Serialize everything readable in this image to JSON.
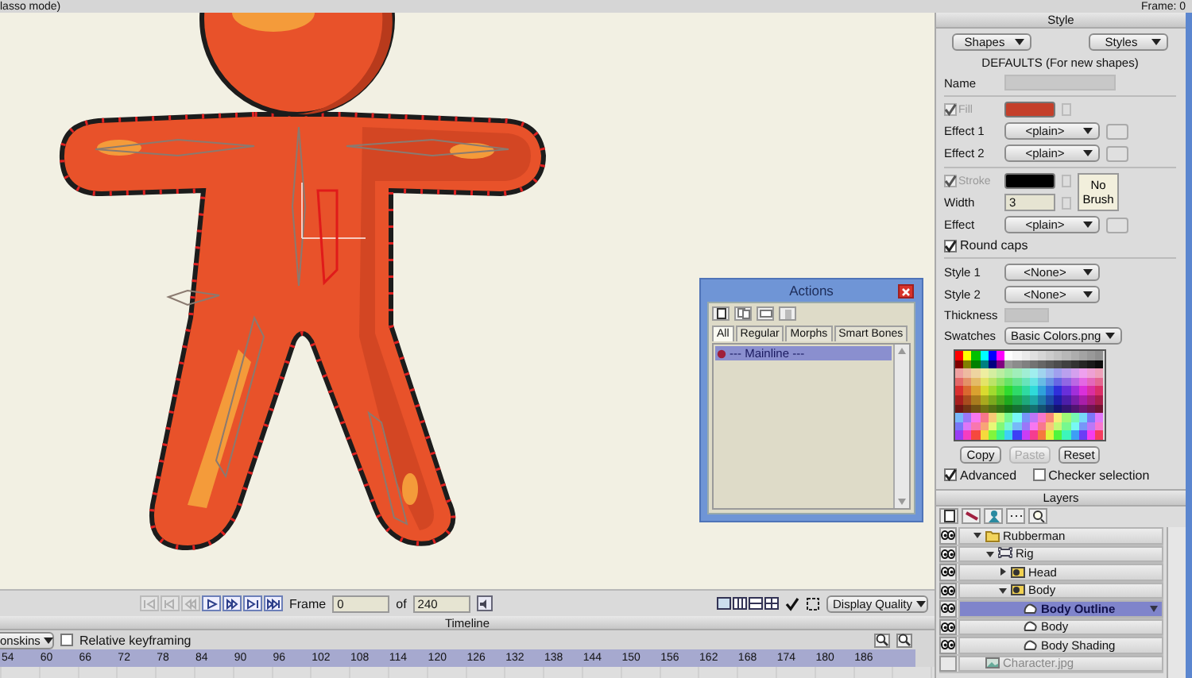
{
  "status_bar": {
    "mode_text": "lasso mode)",
    "frame": "Frame: 0"
  },
  "actions_window": {
    "title": "Actions",
    "tabs": [
      {
        "label": "All",
        "selected": true
      },
      {
        "label": "Regular",
        "selected": false
      },
      {
        "label": "Morphs",
        "selected": false
      },
      {
        "label": "Smart Bones",
        "selected": false
      }
    ],
    "items": [
      {
        "label": "--- Mainline ---",
        "selected": true
      }
    ]
  },
  "playback": {
    "transport": [
      {
        "kind": "first",
        "disabled": true
      },
      {
        "kind": "prev_key",
        "disabled": true
      },
      {
        "kind": "prev_frame",
        "disabled": true
      },
      {
        "kind": "play",
        "disabled": false
      },
      {
        "kind": "next_frame",
        "disabled": false
      },
      {
        "kind": "next_key",
        "disabled": false
      },
      {
        "kind": "last",
        "disabled": false
      }
    ],
    "frame_label": "Frame",
    "frame_value": "0",
    "of_label": "of",
    "total_frames": "240",
    "display_quality": "Display Quality"
  },
  "timeline": {
    "title": "Timeline",
    "dropdown": "onskins",
    "relative_keyframing": {
      "label": "Relative keyframing",
      "checked": false
    },
    "ruler": [
      "54",
      "60",
      "66",
      "72",
      "78",
      "84",
      "90",
      "96",
      "102",
      "108",
      "114",
      "120",
      "126",
      "132",
      "138",
      "144",
      "150",
      "156",
      "162",
      "168",
      "174",
      "180",
      "186"
    ]
  },
  "style_panel": {
    "title": "Style",
    "menus": [
      "Shapes",
      "Styles"
    ],
    "defaults_label": "DEFAULTS (For new shapes)",
    "name_label": "Name",
    "fill": {
      "label": "Fill",
      "checked": true,
      "disabled": true,
      "color": "#c43f2a"
    },
    "fill_effects": [
      {
        "label": "Effect 1",
        "value": "<plain>"
      },
      {
        "label": "Effect 2",
        "value": "<plain>"
      }
    ],
    "stroke": {
      "label": "Stroke",
      "checked": true,
      "disabled": true,
      "color": "#000000"
    },
    "width": {
      "label": "Width",
      "value": "3"
    },
    "brush_button": "No Brush",
    "stroke_effect": {
      "label": "Effect",
      "value": "<plain>"
    },
    "round_caps": {
      "label": "Round caps",
      "checked": true
    },
    "styles": [
      {
        "label": "Style 1",
        "value": "<None>"
      },
      {
        "label": "Style 2",
        "value": "<None>"
      }
    ],
    "thickness": {
      "label": "Thickness",
      "disabled": true
    },
    "swatches": {
      "label": "Swatches",
      "value": "Basic Colors.png"
    },
    "buttons": [
      {
        "label": "Copy",
        "disabled": false
      },
      {
        "label": "Paste",
        "disabled": true
      },
      {
        "label": "Reset",
        "disabled": false
      }
    ],
    "advanced": {
      "label": "Advanced",
      "checked": true
    },
    "checker_selection": {
      "label": "Checker selection",
      "checked": false
    }
  },
  "layers_panel": {
    "title": "Layers",
    "layers": [
      {
        "name": "Rubberman",
        "kind": "folder",
        "visible": true,
        "expanded": true,
        "selected": false,
        "children": [
          {
            "name": "Rig",
            "kind": "bone",
            "visible": true,
            "expanded": true,
            "selected": false,
            "children": [
              {
                "name": "Head",
                "kind": "group",
                "visible": true,
                "expanded": false,
                "selected": false
              },
              {
                "name": "Body",
                "kind": "group",
                "visible": true,
                "expanded": true,
                "selected": false,
                "children": [
                  {
                    "name": "Body Outline",
                    "kind": "vector",
                    "visible": true,
                    "selected": true
                  },
                  {
                    "name": "Body",
                    "kind": "vector",
                    "visible": true,
                    "selected": false
                  },
                  {
                    "name": "Body Shading",
                    "kind": "vector",
                    "visible": true,
                    "selected": false
                  }
                ]
              }
            ]
          }
        ]
      },
      {
        "name": "Character.jpg",
        "kind": "image",
        "visible": false,
        "selected": false
      }
    ]
  }
}
